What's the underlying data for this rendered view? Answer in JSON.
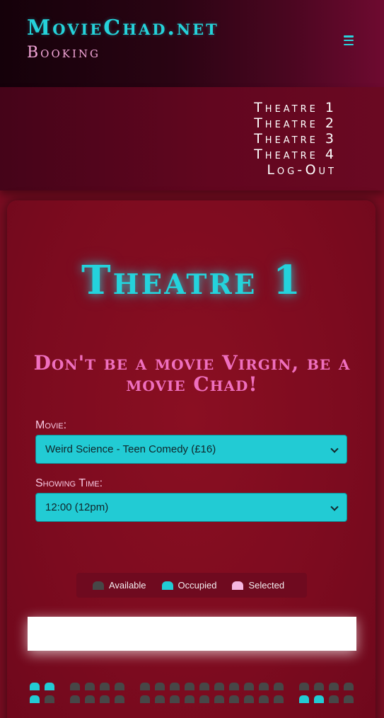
{
  "header": {
    "brand": "MovieChad.net",
    "subtitle": "Booking",
    "menu_icon": "hamburger-icon"
  },
  "nav": {
    "items": [
      {
        "label": "Theatre 1"
      },
      {
        "label": "Theatre 2"
      },
      {
        "label": "Theatre 3"
      },
      {
        "label": "Theatre 4"
      },
      {
        "label": "Log-Out"
      }
    ]
  },
  "main": {
    "title": "Theatre 1",
    "tagline": "Don't be a movie Virgin, be a movie Chad!",
    "movie": {
      "label": "Movie:",
      "selected": "Weird Science - Teen Comedy (£16)"
    },
    "showing": {
      "label": "Showing Time:",
      "selected": "12:00 (12pm)"
    }
  },
  "legend": {
    "available": "Available",
    "occupied": "Occupied",
    "selected": "Selected"
  },
  "colors": {
    "accent_cyan": "#22cbd4",
    "accent_pink": "#ef6fbf",
    "seat_available": "#474747",
    "seat_occupied": "#22cbd4",
    "seat_selected": "#f7b6e0",
    "background": "#7a0d22"
  },
  "seats": {
    "rows": [
      [
        "occupied",
        "occupied",
        "available",
        "available",
        "available",
        "available",
        "available",
        "available",
        "available",
        "available",
        "available",
        "available",
        "available",
        "available",
        "available",
        "available",
        "available",
        "available",
        "available",
        "available"
      ],
      [
        "occupied",
        "available",
        "available",
        "available",
        "available",
        "available",
        "available",
        "available",
        "available",
        "available",
        "available",
        "available",
        "available",
        "available",
        "available",
        "available",
        "occupied",
        "occupied",
        "available",
        "available"
      ]
    ]
  }
}
